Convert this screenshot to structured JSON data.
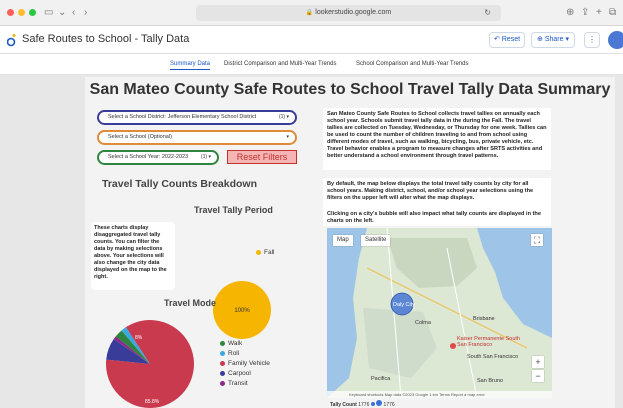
{
  "browser": {
    "url": "lookerstudio.google.com"
  },
  "app": {
    "title": "Safe Routes to School - Tally Data",
    "reset_label": "Reset",
    "share_label": "Share",
    "brand_color": "#1a56c4"
  },
  "page_tabs": [
    {
      "label": "Summary Data",
      "active": true
    },
    {
      "label": "District Comparison and Multi-Year Trends",
      "active": false
    },
    {
      "label": "School Comparison and Multi-Year Trends",
      "active": false
    }
  ],
  "report": {
    "title": "San Mateo County Safe Routes to School Travel Tally Data Summary",
    "filters": {
      "district": {
        "label": "Select a School District:",
        "value": "Jefferson Elementary School District",
        "suffix": "(1)"
      },
      "school": {
        "label": "Select a School (Optional)"
      },
      "year": {
        "label": "Select a School Year:",
        "value": "2022-2023",
        "suffix": "(1)"
      }
    },
    "reset_filters_label": "Reset Filters",
    "info_text_1": "San Mateo County Safe Routes to School collects travel tallies on annually each school year. Schools submit travel tally data in the during the Fall. The travel tallies are collected on Tuesday, Wednesday, or Thursday for one week. Tallies can be used to count the number of children traveling to and from school using different modes of travel, such as walking, bicycling, bus, private vehicle, etc. Travel behavior enables a program to measure changes after SRTS activities and better understand a school environment through travel patterns.",
    "info_text_2": "By default, the map below displays the total travel tally counts by city for all school years. Making district, school, and/or school year selections using the filters on the upper left will alter what the map displays.",
    "info_text_3": "Clicking on a city's bubble will also impact what tally counts are displayed in the charts on the left.",
    "breakdown_title": "Travel Tally Counts Breakdown",
    "period_title": "Travel Tally Period",
    "side_note": "These charts display disaggregated travel tally counts. You can filter the data by making selections above. Your selections will also change the city data displayed on the map to the right.",
    "mode_title": "Travel Mode"
  },
  "chart_data": [
    {
      "type": "pie",
      "title": "Travel Tally Period",
      "slices": [
        {
          "label": "Fall",
          "value": 100,
          "color": "#f6b500"
        }
      ],
      "data_labels": [
        "100%"
      ]
    },
    {
      "type": "pie",
      "title": "Travel Mode",
      "slices": [
        {
          "label": "Walk",
          "value": 3,
          "color": "#2e8540"
        },
        {
          "label": "Roll",
          "value": 2,
          "color": "#3aa9e0"
        },
        {
          "label": "Family Vehicle",
          "value": 85.8,
          "color": "#c93a4e"
        },
        {
          "label": "Carpool",
          "value": 8,
          "color": "#3a3c9a"
        },
        {
          "label": "Transit",
          "value": 1.2,
          "color": "#8a2a8a"
        }
      ],
      "data_labels": [
        "8%",
        "85.8%"
      ]
    }
  ],
  "map": {
    "map_label": "Map",
    "satellite_label": "Satellite",
    "cities": [
      "Daly City",
      "Colma",
      "Brisbane",
      "South San Francisco",
      "San Bruno",
      "Pacifica"
    ],
    "poi": "Kaiser Permanente South San Francisco",
    "footer": "Keyboard shortcuts  Map data ©2023 Google  1 km  Terms  Report a map error",
    "legend_label": "Tally Count",
    "legend_values": [
      "1776",
      "1776"
    ],
    "bubble_color": "#3b6fd4"
  }
}
